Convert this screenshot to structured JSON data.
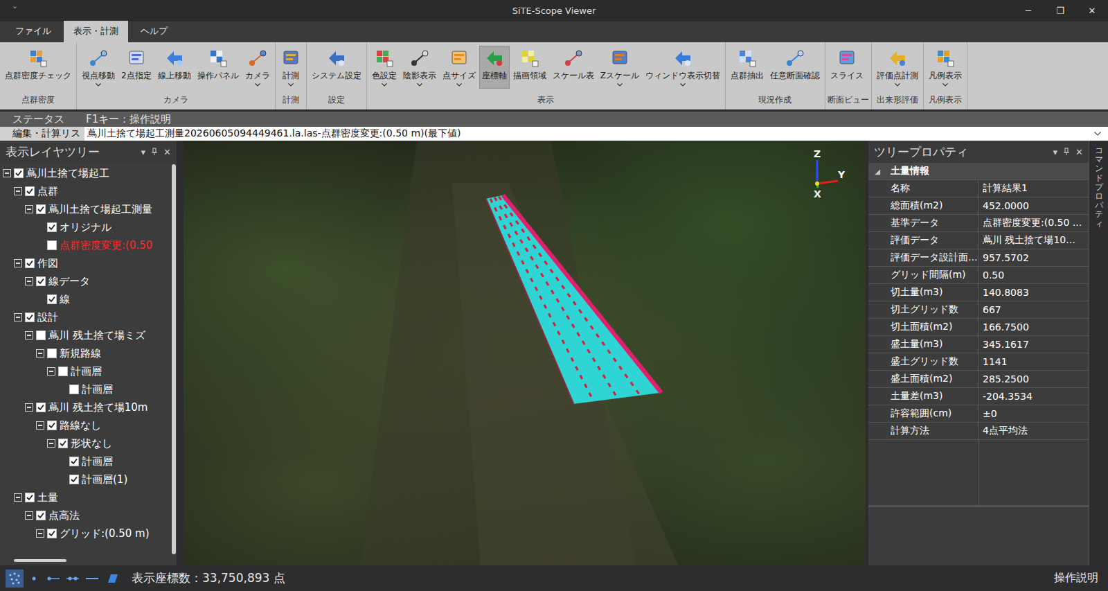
{
  "window": {
    "title": "SiTE-Scope Viewer",
    "quickAccess": "ˇ",
    "controls": [
      "─",
      "❐",
      "✕"
    ]
  },
  "menuTabs": [
    {
      "label": "ファイル",
      "selected": false
    },
    {
      "label": "表示・計測",
      "selected": true
    },
    {
      "label": "ヘルプ",
      "selected": false
    }
  ],
  "ribbon": [
    {
      "caption": "点群密度",
      "buttons": [
        {
          "label": "点群密度チェック",
          "dropdown": false,
          "selected": false
        }
      ]
    },
    {
      "caption": "カメラ",
      "buttons": [
        {
          "label": "視点移動",
          "dropdown": true,
          "selected": false
        },
        {
          "label": "2点指定",
          "dropdown": false,
          "selected": false
        },
        {
          "label": "線上移動",
          "dropdown": false,
          "selected": false
        },
        {
          "label": "操作パネル",
          "dropdown": false,
          "selected": false
        },
        {
          "label": "カメラ",
          "dropdown": true,
          "selected": false
        }
      ]
    },
    {
      "caption": "計測",
      "buttons": [
        {
          "label": "計測",
          "dropdown": true,
          "selected": false
        }
      ]
    },
    {
      "caption": "設定",
      "buttons": [
        {
          "label": "システム設定",
          "dropdown": false,
          "selected": false
        }
      ]
    },
    {
      "caption": "表示",
      "buttons": [
        {
          "label": "色設定",
          "dropdown": true,
          "selected": false
        },
        {
          "label": "陰影表示",
          "dropdown": true,
          "selected": false
        },
        {
          "label": "点サイズ",
          "dropdown": true,
          "selected": false
        },
        {
          "label": "座標軸",
          "dropdown": false,
          "selected": true
        },
        {
          "label": "描画領域",
          "dropdown": false,
          "selected": false
        },
        {
          "label": "スケール表",
          "dropdown": false,
          "selected": false
        },
        {
          "label": "Zスケール",
          "dropdown": true,
          "selected": false
        },
        {
          "label": "ウィンドウ表示切替",
          "dropdown": true,
          "selected": false
        }
      ]
    },
    {
      "caption": "現況作成",
      "buttons": [
        {
          "label": "点群抽出",
          "dropdown": false,
          "selected": false
        },
        {
          "label": "任意断面確認",
          "dropdown": false,
          "selected": false
        }
      ]
    },
    {
      "caption": "断面ビュー",
      "buttons": [
        {
          "label": "スライス",
          "dropdown": false,
          "selected": false
        }
      ]
    },
    {
      "caption": "出来形評価",
      "buttons": [
        {
          "label": "評価点計測",
          "dropdown": true,
          "selected": false
        }
      ]
    },
    {
      "caption": "凡例表示",
      "buttons": [
        {
          "label": "凡例表示",
          "dropdown": true,
          "selected": false
        }
      ]
    }
  ],
  "statusRow": {
    "label": "ステータス",
    "text": "F1キー：操作説明"
  },
  "editRow": {
    "label": "編集・計算リス",
    "value": "蔦川土捨て場起工測量20260605094449461.la.las-点群密度変更:(0.50 m)(最下値)"
  },
  "layerTree": {
    "title": "表示レイヤツリー",
    "menuGlyph": "▾",
    "closeGlyph": "✕",
    "items": [
      {
        "label": "蔦川土捨て場起工",
        "level": 0,
        "kind": "branch",
        "expanded": true,
        "checked": true,
        "color": "#ffffff"
      },
      {
        "label": "点群",
        "level": 1,
        "kind": "branch",
        "expanded": true,
        "checked": true,
        "color": "#ffffff"
      },
      {
        "label": "蔦川土捨て場起工測量",
        "level": 2,
        "kind": "branch",
        "expanded": true,
        "checked": true,
        "color": "#ffffff"
      },
      {
        "label": "オリジナル",
        "level": 3,
        "kind": "leaf",
        "expanded": false,
        "checked": true,
        "color": "#ffffff"
      },
      {
        "label": "点群密度変更:(0.50",
        "level": 3,
        "kind": "leaf",
        "expanded": false,
        "checked": false,
        "color": "#ff2a2a"
      },
      {
        "label": "作図",
        "level": 1,
        "kind": "branch",
        "expanded": true,
        "checked": true,
        "color": "#ffffff"
      },
      {
        "label": "線データ",
        "level": 2,
        "kind": "branch",
        "expanded": true,
        "checked": true,
        "color": "#ffffff"
      },
      {
        "label": "線",
        "level": 3,
        "kind": "leaf",
        "expanded": false,
        "checked": true,
        "color": "#ffffff"
      },
      {
        "label": "設計",
        "level": 1,
        "kind": "branch",
        "expanded": true,
        "checked": true,
        "color": "#ffffff"
      },
      {
        "label": "蔦川 残土捨て場ミズ",
        "level": 2,
        "kind": "branch",
        "expanded": true,
        "checked": false,
        "color": "#ffffff"
      },
      {
        "label": "新規路線",
        "level": 3,
        "kind": "branch",
        "expanded": true,
        "checked": false,
        "color": "#ffffff"
      },
      {
        "label": "計画層",
        "level": 4,
        "kind": "branch",
        "expanded": true,
        "checked": false,
        "color": "#ffffff"
      },
      {
        "label": "計画層",
        "level": 5,
        "kind": "leaf",
        "expanded": false,
        "checked": false,
        "color": "#ffffff"
      },
      {
        "label": "蔦川 残土捨て場10m",
        "level": 2,
        "kind": "branch",
        "expanded": true,
        "checked": true,
        "color": "#ffffff"
      },
      {
        "label": "路線なし",
        "level": 3,
        "kind": "branch",
        "expanded": true,
        "checked": true,
        "color": "#ffffff"
      },
      {
        "label": "形状なし",
        "level": 4,
        "kind": "branch",
        "expanded": true,
        "checked": true,
        "color": "#ffffff"
      },
      {
        "label": "計画層",
        "level": 5,
        "kind": "leaf",
        "expanded": false,
        "checked": true,
        "color": "#ffffff"
      },
      {
        "label": "計画層(1)",
        "level": 5,
        "kind": "leaf",
        "expanded": false,
        "checked": true,
        "color": "#ffffff"
      },
      {
        "label": "土量",
        "level": 1,
        "kind": "branch",
        "expanded": true,
        "checked": true,
        "color": "#ffffff"
      },
      {
        "label": "点高法",
        "level": 2,
        "kind": "branch",
        "expanded": true,
        "checked": true,
        "color": "#ffffff"
      },
      {
        "label": "グリッド:(0.50 m)",
        "level": 3,
        "kind": "branch",
        "expanded": true,
        "checked": true,
        "color": "#ffffff"
      }
    ]
  },
  "viewport": {
    "axes": [
      {
        "label": "Z",
        "color": "#2b4dff"
      },
      {
        "label": "Y",
        "color": "#e02020"
      },
      {
        "label": "X",
        "color": "#22c022"
      }
    ]
  },
  "properties": {
    "title": "ツリープロパティ",
    "menuGlyph": "▾",
    "closeGlyph": "✕",
    "section": {
      "toggle": "◢",
      "label": "土量情報"
    },
    "rows": [
      {
        "key": "名称",
        "value": "計算結果1"
      },
      {
        "key": "総面積(m2)",
        "value": "452.0000"
      },
      {
        "key": "基準データ",
        "value": "点群密度変更:(0.50 ..."
      },
      {
        "key": "評価データ",
        "value": "蔦川 残土捨て場10..."
      },
      {
        "key": "評価データ設計面...",
        "value": "957.5702"
      },
      {
        "key": "グリッド間隔(m)",
        "value": "0.50"
      },
      {
        "key": "切土量(m3)",
        "value": "140.8083"
      },
      {
        "key": "切土グリッド数",
        "value": "667"
      },
      {
        "key": "切土面積(m2)",
        "value": "166.7500"
      },
      {
        "key": "盛土量(m3)",
        "value": "345.1617"
      },
      {
        "key": "盛土グリッド数",
        "value": "1141"
      },
      {
        "key": "盛土面積(m2)",
        "value": "285.2500"
      },
      {
        "key": "土量差(m3)",
        "value": "-204.3534"
      },
      {
        "key": "許容範囲(cm)",
        "value": "±0"
      },
      {
        "key": "計算方法",
        "value": "4点平均法"
      }
    ]
  },
  "sideTab": {
    "label": "コマンドプロパティ"
  },
  "statusBar": {
    "viewModes": [
      {
        "selected": true
      },
      {
        "selected": false
      },
      {
        "selected": false
      },
      {
        "selected": false
      },
      {
        "selected": false
      },
      {
        "selected": false
      }
    ],
    "text": "表示座標数：33,750,893 点",
    "help": "操作説明"
  }
}
